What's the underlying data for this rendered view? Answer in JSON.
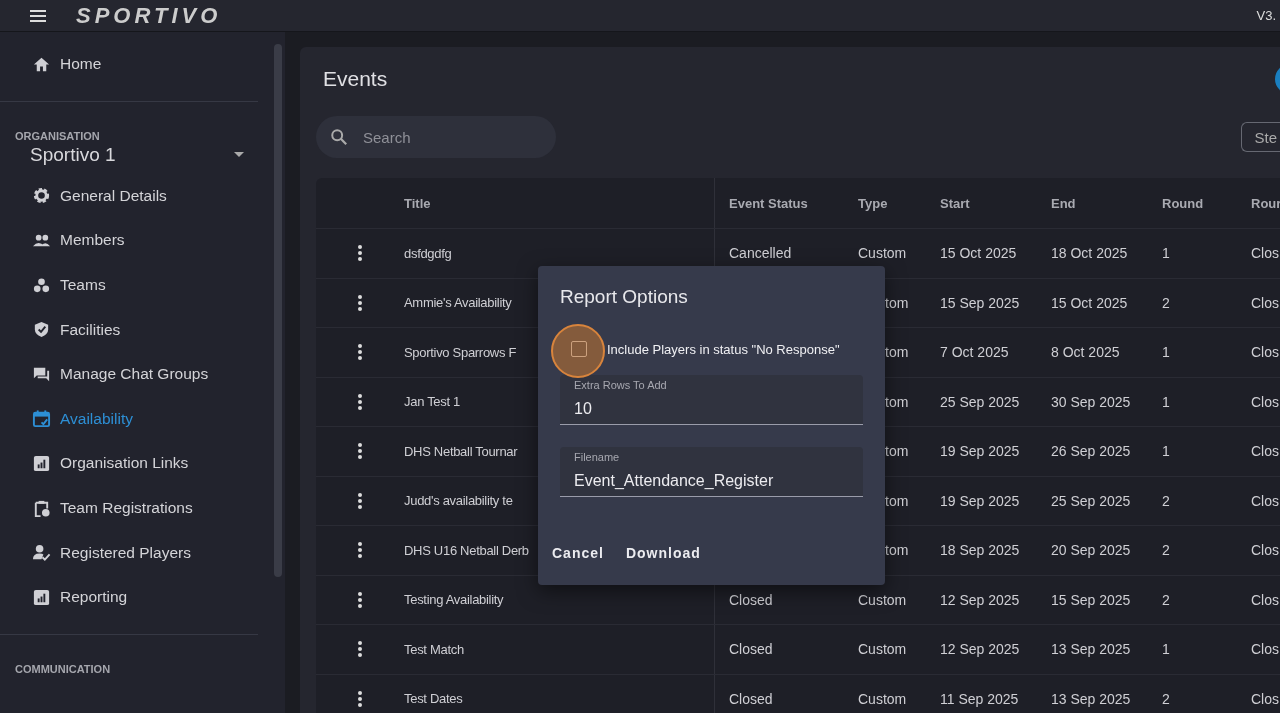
{
  "topbar": {
    "logo": "SPORTIVO",
    "version": "V3."
  },
  "sidebar": {
    "home": {
      "label": "Home",
      "kind": "home",
      "selected": false
    },
    "sections": [
      {
        "heading": "ORGANISATION",
        "organisation": "Sportivo 1",
        "items": [
          {
            "label": "General Details",
            "kind": "gear",
            "selected": false
          },
          {
            "label": "Members",
            "kind": "people",
            "selected": false
          },
          {
            "label": "Teams",
            "kind": "dots",
            "selected": false
          },
          {
            "label": "Facilities",
            "kind": "badge",
            "selected": false
          },
          {
            "label": "Manage Chat Groups",
            "kind": "chat",
            "selected": false
          },
          {
            "label": "Availability",
            "kind": "calendar",
            "selected": true
          },
          {
            "label": "Organisation Links",
            "kind": "chart",
            "selected": false
          },
          {
            "label": "Team Registrations",
            "kind": "clipboard",
            "selected": false
          },
          {
            "label": "Registered Players",
            "kind": "person",
            "selected": false
          },
          {
            "label": "Reporting",
            "kind": "chart",
            "selected": false
          }
        ]
      },
      {
        "heading": "COMMUNICATION"
      }
    ]
  },
  "events": {
    "title": "Events",
    "search": {
      "placeholder": "Search"
    },
    "filter_button": "Ste",
    "columns": [
      "Title",
      "Event Status",
      "Type",
      "Start",
      "End",
      "Round",
      "Rour"
    ],
    "rows": [
      {
        "title": "dsfdgdfg",
        "status": "Cancelled",
        "type": "Custom",
        "start": "15 Oct 2025",
        "end": "18 Oct 2025",
        "round": "1",
        "column_8": "Clos"
      },
      {
        "title": "Ammie's Availability",
        "type": "tom",
        "type_clipped": true,
        "start": "15 Sep 2025",
        "end": "15 Oct 2025",
        "round": "2",
        "column_8": "Clos"
      },
      {
        "title": "Sportivo Sparrows F",
        "type": "tom",
        "type_clipped": true,
        "start": "7 Oct 2025",
        "end": "8 Oct 2025",
        "round": "1",
        "column_8": "Clos"
      },
      {
        "title": "Jan Test 1",
        "type": "tom",
        "type_clipped": true,
        "start": "25 Sep 2025",
        "end": "30 Sep 2025",
        "round": "1",
        "column_8": "Clos"
      },
      {
        "title": "DHS Netball Tournar",
        "type": "tom",
        "type_clipped": true,
        "start": "19 Sep 2025",
        "end": "26 Sep 2025",
        "round": "1",
        "column_8": "Clos"
      },
      {
        "title": "Judd's availability te",
        "type": "tom",
        "type_clipped": true,
        "start": "19 Sep 2025",
        "end": "25 Sep 2025",
        "round": "2",
        "column_8": "Clos"
      },
      {
        "title": "DHS U16 Netball Derb",
        "type": "tom",
        "type_clipped": true,
        "start": "18 Sep 2025",
        "end": "20 Sep 2025",
        "round": "2",
        "column_8": "Clos"
      },
      {
        "title": "Testing Availability",
        "status": "Closed",
        "type": "Custom",
        "start": "12 Sep 2025",
        "end": "15 Sep 2025",
        "round": "2",
        "column_8": "Clos"
      },
      {
        "title": "Test Match",
        "status": "Closed",
        "type": "Custom",
        "start": "12 Sep 2025",
        "end": "13 Sep 2025",
        "round": "1",
        "column_8": "Clos"
      },
      {
        "title": "Test Dates",
        "status": "Closed",
        "type": "Custom",
        "start": "11 Sep 2025",
        "end": "13 Sep 2025",
        "round": "2",
        "column_8": "Clos"
      }
    ]
  },
  "dialog": {
    "title": "Report Options",
    "checkbox": {
      "label": "Include Players in status \"No Response\"",
      "checked": false
    },
    "fields": [
      {
        "label": "Extra Rows To Add",
        "value": "10"
      },
      {
        "label": "Filename",
        "value": "Event_Attendance_Register"
      }
    ],
    "buttons": [
      "Cancel",
      "Download"
    ]
  }
}
